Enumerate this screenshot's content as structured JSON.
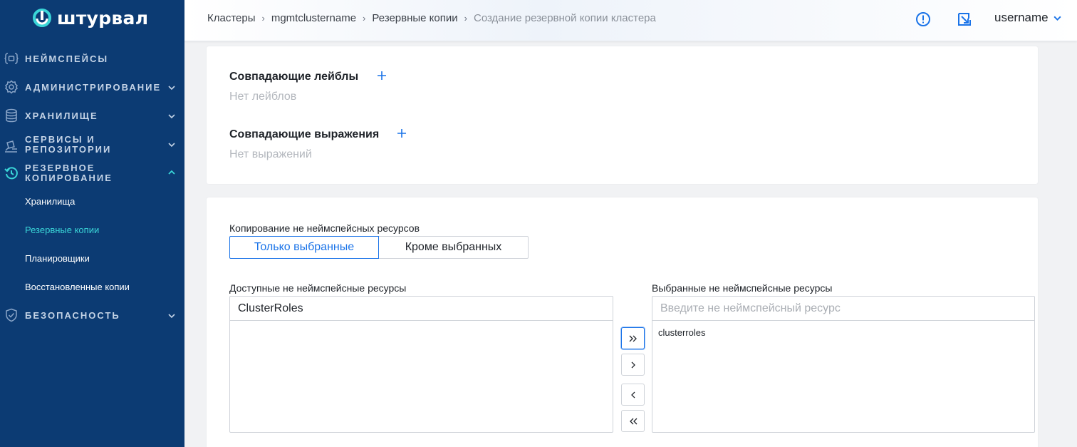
{
  "app": {
    "logo_text": "штурвал"
  },
  "sidebar": {
    "items": [
      {
        "label": "Неймспейсы",
        "icon": "namespace-icon"
      },
      {
        "label": "Администрирование",
        "icon": "gear-icon"
      },
      {
        "label": "Хранилище",
        "icon": "database-icon"
      },
      {
        "label": "Сервисы и репозитории",
        "icon": "services-icon"
      },
      {
        "label": "Резервное копирование",
        "icon": "backup-icon"
      },
      {
        "label": "Безопасность",
        "icon": "shield-icon"
      }
    ],
    "backup_subitems": [
      {
        "label": "Хранилища"
      },
      {
        "label": "Резервные копии"
      },
      {
        "label": "Планировщики"
      },
      {
        "label": "Восстановленные копии"
      }
    ]
  },
  "header": {
    "breadcrumb": [
      "Кластеры",
      "mgmtclustername",
      "Резервные копии",
      "Создание резервной копии кластера"
    ],
    "username": "username"
  },
  "labels_card": {
    "matching_labels_title": "Совпадающие лейблы",
    "no_labels": "Нет лейблов",
    "matching_expressions_title": "Совпадающие выражения",
    "no_expressions": "Нет выражений"
  },
  "resources_card": {
    "copy_mode_label": "Копирование не неймспейсных ресурсов",
    "mode_only_selected": "Только выбранные",
    "mode_except_selected": "Кроме выбранных",
    "available_label": "Доступные не неймспейсные ресурсы",
    "available_filter_value": "ClusterRoles",
    "selected_label": "Выбранные не неймспейсные ресурсы",
    "selected_input_placeholder": "Введите не неймспейсный ресурс",
    "selected_items": [
      "clusterroles"
    ]
  },
  "colors": {
    "sidebar_bg": "#0c3b73",
    "accent": "#1a73e8",
    "active_subitem": "#3ad6d8"
  }
}
